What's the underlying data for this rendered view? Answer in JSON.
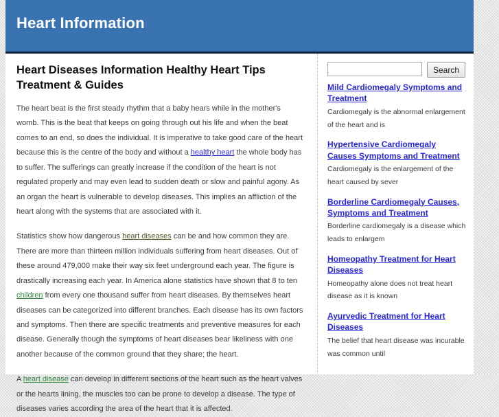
{
  "site": {
    "title": "Heart Information",
    "header_bg": "#3a73b2",
    "header_border": "#11203a"
  },
  "content": {
    "article_title": "Heart Diseases Information Healthy Heart Tips Treatment & Guides",
    "paragraphs": [
      {
        "before": "The heart beat is the first steady rhythm that a baby hears while in the mother's womb. This is the beat that keeps on going through out his life and when the beat comes to an end, so does the individual. It is imperative to take good care of the heart because this is the centre of the body and without a ",
        "link": "healthy heart",
        "link_color": "#2727d8",
        "after": " the whole body has to suffer. The sufferings can greatly increase if the condition of the heart is not regulated properly and may even lead to sudden death or slow and painful agony. As an organ the heart is vulnerable to develop diseases. This implies an affliction of the heart along with the systems that are associated with it."
      },
      {
        "before": "Statistics show how dangerous ",
        "link": "heart diseases",
        "link_color": "#4a5b23",
        "middle": " can be and how common they are. There are more than thirteen million individuals suffering from heart diseases. Out of these around 479,000 make their way six feet underground each year. The figure is drastically increasing each year. In America alone statistics have shown that 8 to ten ",
        "link2": "children",
        "link2_color": "#2f8a3d",
        "after": " from every one thousand suffer from heart diseases. By themselves heart diseases can be categorized into different branches. Each disease has its own factors and symptoms. Then there are specific treatments and preventive measures for each disease. Generally though the symptoms of heart diseases bear likeliness with one another because of the common ground that they share; the heart."
      },
      {
        "before": "A ",
        "link": "heart disease",
        "link_color": "#2f8a3d",
        "after": " can develop in different sections of the heart such as the heart valves or the hearts lining, the muscles too can be prone to develop a disease. The type of diseases varies according the area of the heart that it is affected."
      }
    ]
  },
  "sidebar": {
    "search": {
      "value": "",
      "placeholder": "",
      "button_label": "Search"
    },
    "posts": [
      {
        "title": "Mild Cardiomegaly Symptoms and Treatment",
        "excerpt": "Cardiomegaly is the abnormal enlargement of the heart and is"
      },
      {
        "title": "Hypertensive Cardiomegaly Causes Symptoms and Treatment",
        "excerpt": "Cardiomegaly is the enlargement of the heart caused by sever"
      },
      {
        "title": "Borderline Cardiomegaly Causes, Symptoms and Treatment",
        "excerpt": "Borderline cardiomegaly is a disease which leads to enlargem"
      },
      {
        "title": "Homeopathy Treatment for Heart Diseases",
        "excerpt": "Homeopathy alone does not treat heart disease as it is known"
      },
      {
        "title": "Ayurvedic Treatment for Heart Diseases",
        "excerpt": "The belief that heart disease was incurable was common until"
      }
    ]
  }
}
